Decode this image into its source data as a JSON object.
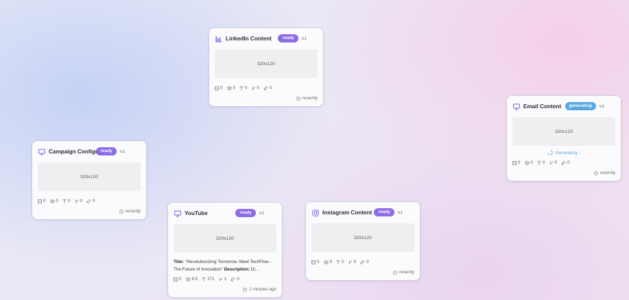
{
  "colors": {
    "ready_badge": "#8c6be6",
    "generating_badge": "#5aa7e0",
    "icon_accent": "#7b5fe0"
  },
  "cards": [
    {
      "id": "linkedin",
      "title": "LinkedIn Content",
      "icon": "bar-chart-icon",
      "status": "ready",
      "version": "v1",
      "preview": "320x120",
      "stats": {
        "images": "0",
        "layers": "0",
        "text": "0",
        "versions": "0",
        "links": "0"
      },
      "timestamp": "recently"
    },
    {
      "id": "email",
      "title": "Email Content",
      "icon": "monitor-icon",
      "status": "generating",
      "version": "v1",
      "preview": "320x120",
      "generating_text": "Generating...",
      "stats": {
        "images": "0",
        "layers": "0",
        "text": "0",
        "versions": "0",
        "links": "0"
      },
      "timestamp": "recently"
    },
    {
      "id": "campaign",
      "title": "Campaign Configuration",
      "icon": "monitor-icon",
      "status": "ready",
      "version": "v1",
      "preview": "320x120",
      "stats": {
        "images": "0",
        "layers": "0",
        "text": "0",
        "versions": "0",
        "links": "0"
      },
      "timestamp": "recently"
    },
    {
      "id": "youtube",
      "title": "YouTube",
      "icon": "monitor-icon",
      "status": "ready",
      "version": "v1",
      "preview": "320x120",
      "desc_title_label": "Title:",
      "desc_title_text": "\"Revolutionizing Tomorrow: Meet TechFlow - The Future of Innovation\"",
      "desc_description_label": "Description:",
      "desc_description_text": "Di...",
      "stats": {
        "images": "0",
        "layers": "9.5",
        "text": "271",
        "versions": "1",
        "links": "0"
      },
      "timestamp": "2 minutes ago"
    },
    {
      "id": "instagram",
      "title": "Instagram Content",
      "icon": "instagram-icon",
      "status": "ready",
      "version": "v1",
      "preview": "320x120",
      "stats": {
        "images": "0",
        "layers": "0",
        "text": "0",
        "versions": "0",
        "links": "0"
      },
      "timestamp": "recently"
    }
  ]
}
